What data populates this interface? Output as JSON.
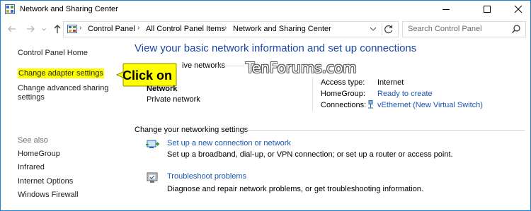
{
  "window": {
    "title": "Network and Sharing Center",
    "accent": "#1883d7"
  },
  "addressbar": {
    "breadcrumbs": [
      "Control Panel",
      "All Control Panel Items",
      "Network and Sharing Center"
    ],
    "search_placeholder": "Search Control Panel"
  },
  "sidebar": {
    "home_link": "Control Panel Home",
    "adapter_link": "Change adapter settings",
    "advanced_link_line1": "Change advanced sharing",
    "advanced_link_line2": "settings",
    "see_also_heading": "See also",
    "see_also": [
      "HomeGroup",
      "Infrared",
      "Internet Options",
      "Windows Firewall"
    ]
  },
  "main": {
    "title": "View your basic network information and set up connections",
    "active_networks_label": "ive networks",
    "network_name": "Network",
    "network_type": "Private network",
    "access_type_label": "Access type:",
    "access_type_value": "Internet",
    "homegroup_label": "HomeGroup:",
    "homegroup_value": "Ready to create",
    "connections_label": "Connections:",
    "connections_value": "vEthernet (New Virtual Switch)",
    "change_settings_heading": "Change your networking settings",
    "tasks": [
      {
        "icon": "new-connection-icon",
        "link": "Set up a new connection or network",
        "desc": "Set up a broadband, dial-up, or VPN connection; or set up a router or access point."
      },
      {
        "icon": "troubleshoot-icon",
        "link": "Troubleshoot problems",
        "desc": "Diagnose and repair network problems, or get troubleshooting information."
      }
    ]
  },
  "annotation": {
    "callout_text": "Click on",
    "callout_color": "#ffff00",
    "watermark": "TenForums.com"
  },
  "colors": {
    "link": "#1a56b0",
    "title_blue": "#1a47a8"
  }
}
